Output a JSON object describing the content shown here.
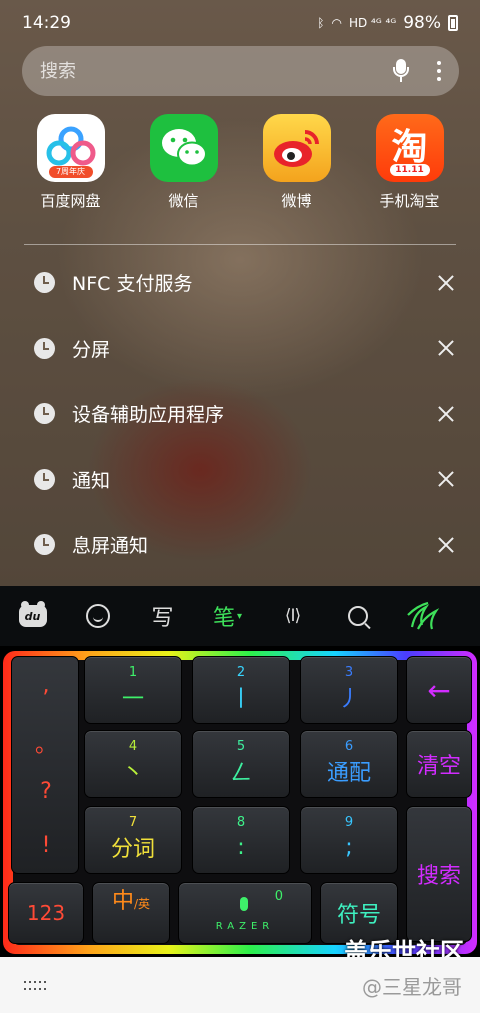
{
  "status": {
    "time": "14:29",
    "net_icons": "HD ⁴ᴳ ⁴ᴳ",
    "battery": "98%"
  },
  "search": {
    "placeholder": "搜索"
  },
  "apps": [
    {
      "label": "百度网盘",
      "badge": "7周年庆"
    },
    {
      "label": "微信"
    },
    {
      "label": "微博"
    },
    {
      "label": "手机淘宝",
      "glyph": "淘",
      "badge": "11.11"
    }
  ],
  "history": [
    {
      "text": "NFC 支付服务"
    },
    {
      "text": "分屏"
    },
    {
      "text": "设备辅助应用程序"
    },
    {
      "text": "通知"
    },
    {
      "text": "息屏通知"
    }
  ],
  "toolbar": {
    "du": "du",
    "write": "写",
    "pen": "笔",
    "cursor": "⟨I⟩"
  },
  "keyboard": {
    "punct": [
      ",",
      "。",
      "?",
      "!"
    ],
    "keys": [
      {
        "num": "1",
        "main": "一",
        "color": "#3ef06a"
      },
      {
        "num": "2",
        "main": "丨",
        "color": "#38d6ff"
      },
      {
        "num": "3",
        "main": "丿",
        "color": "#3a7dff"
      },
      {
        "num": "4",
        "main": "丶",
        "color": "#b8f03a"
      },
      {
        "num": "5",
        "main": "ㄥ",
        "color": "#3ef0a0"
      },
      {
        "num": "6",
        "main": "通配",
        "color": "#3a9dff"
      },
      {
        "num": "7",
        "main": "分词",
        "color": "#f0e03a"
      },
      {
        "num": "8",
        "main": ":",
        "color": "#3ef08a"
      },
      {
        "num": "9",
        "main": ";",
        "color": "#38c6ff"
      },
      {
        "num": "0",
        "main": "RAZER",
        "color": "#3ef06a"
      }
    ],
    "backspace": "←",
    "clear": "清空",
    "search": "搜索",
    "num123": "123",
    "lang_main": "中",
    "lang_sub": "/英",
    "symbols": "符号"
  },
  "watermark": {
    "top": "盖乐世社区",
    "bottom": "@三星龙哥"
  },
  "colors": {
    "accent_green": "#3ee05a",
    "magenta": "#d22cff",
    "red": "#ff4a36"
  }
}
